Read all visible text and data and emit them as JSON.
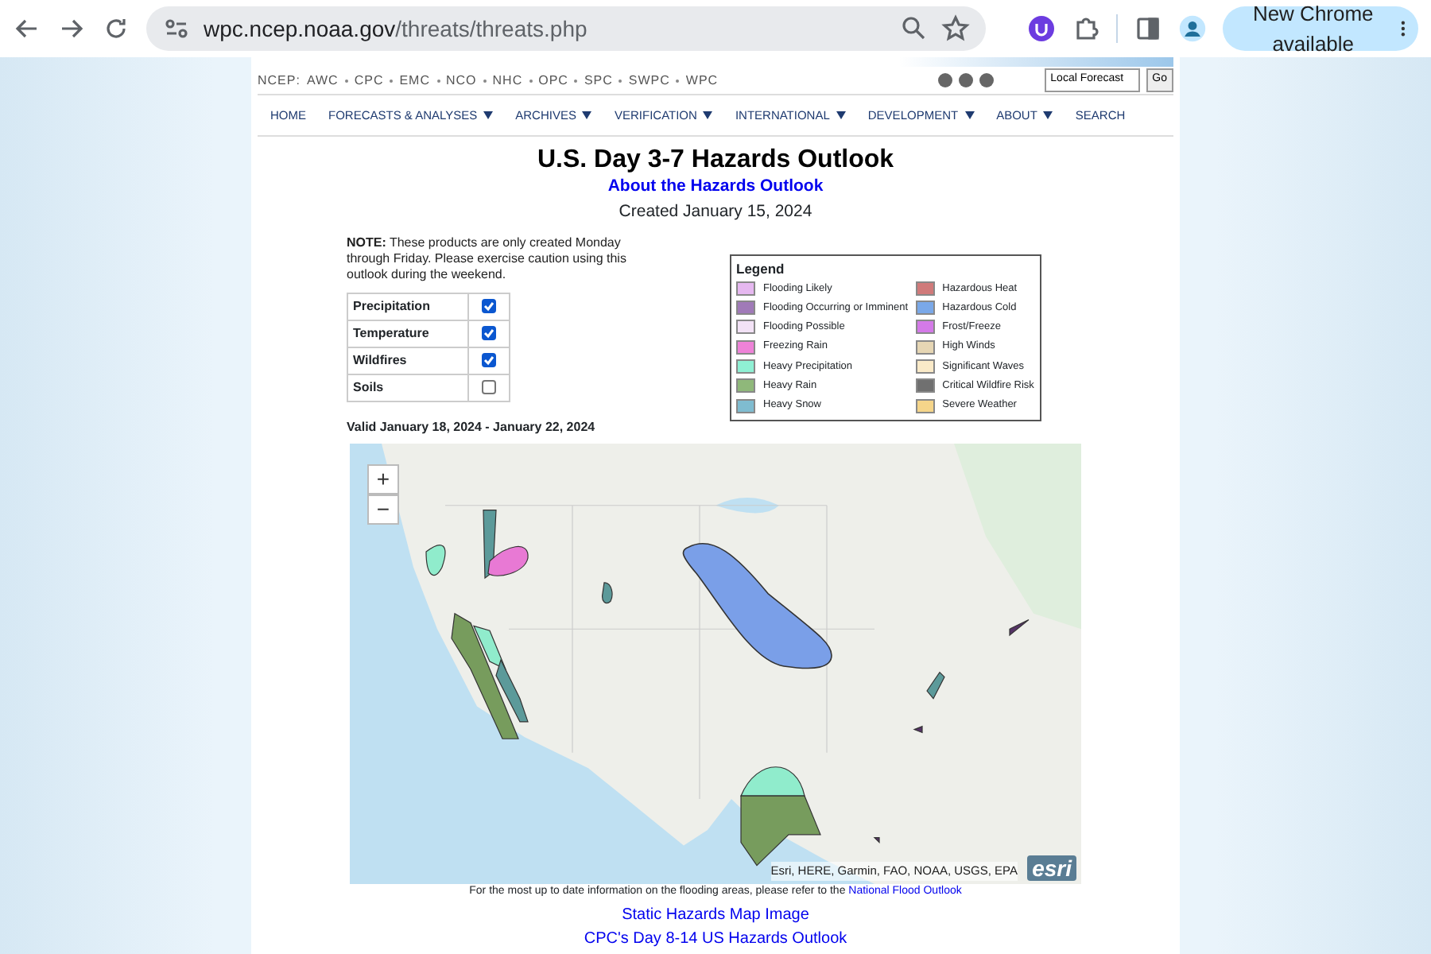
{
  "browser": {
    "url_host": "wpc.ncep.noaa.gov",
    "url_path": "/threats/threats.php",
    "update_button": "New Chrome available"
  },
  "ncep_links": [
    "NCEP:",
    "AWC",
    "CPC",
    "EMC",
    "NCO",
    "NHC",
    "OPC",
    "SPC",
    "SWPC",
    "WPC"
  ],
  "local_forecast": {
    "value": "Local Forecast",
    "button": "Go"
  },
  "nav": [
    {
      "label": "HOME",
      "dropdown": false
    },
    {
      "label": "FORECASTS & ANALYSES",
      "dropdown": true
    },
    {
      "label": "ARCHIVES",
      "dropdown": true
    },
    {
      "label": "VERIFICATION",
      "dropdown": true
    },
    {
      "label": "INTERNATIONAL",
      "dropdown": true
    },
    {
      "label": "DEVELOPMENT",
      "dropdown": true
    },
    {
      "label": "ABOUT",
      "dropdown": true
    },
    {
      "label": "SEARCH",
      "dropdown": false
    }
  ],
  "title": "U.S. Day 3-7 Hazards Outlook",
  "about_link": "About the Hazards Outlook",
  "created": "Created January 15, 2024",
  "note": "**NOTE:** These products are only created Monday through Friday. Please exercise caution using this outlook during the weekend.",
  "layers": [
    {
      "label": "Precipitation",
      "checked": true
    },
    {
      "label": "Temperature",
      "checked": true
    },
    {
      "label": "Wildfires",
      "checked": true
    },
    {
      "label": "Soils",
      "checked": false
    }
  ],
  "valid": "Valid January 18, 2024 - January 22, 2024",
  "legend": {
    "title": "Legend",
    "items": [
      {
        "label": "Flooding Likely",
        "color": "#e6b8f0"
      },
      {
        "label": "Flooding Occurring or Imminent",
        "color": "#a07ab8"
      },
      {
        "label": "Flooding Possible",
        "color": "#f3e2f6"
      },
      {
        "label": "Freezing Rain",
        "color": "#ee82d8"
      },
      {
        "label": "Heavy Precipitation",
        "color": "#8ff0d4"
      },
      {
        "label": "Heavy Rain",
        "color": "#8fb87a"
      },
      {
        "label": "Heavy Snow",
        "color": "#7fbcd0"
      },
      {
        "label": "Hazardous Heat",
        "color": "#d07a7a"
      },
      {
        "label": "Hazardous Cold",
        "color": "#7aa8e8"
      },
      {
        "label": "Frost/Freeze",
        "color": "#d47ae8"
      },
      {
        "label": "High Winds",
        "color": "#e6d6b4"
      },
      {
        "label": "Significant Waves",
        "color": "#faeac8"
      },
      {
        "label": "Critical Wildfire Risk",
        "color": "#707070"
      },
      {
        "label": "Severe Weather",
        "color": "#f5d58a"
      }
    ]
  },
  "map": {
    "zoom_in": "+",
    "zoom_out": "−",
    "attribution": "Esri, HERE, Garmin, FAO, NOAA, USGS, EPA",
    "logo": "esri"
  },
  "caption": {
    "text": "For the most up to date information on the flooding areas, please refer to the",
    "link": "National Flood Outlook"
  },
  "links": [
    "Static Hazards Map Image",
    "CPC's Day 8-14 US Hazards Outlook"
  ]
}
